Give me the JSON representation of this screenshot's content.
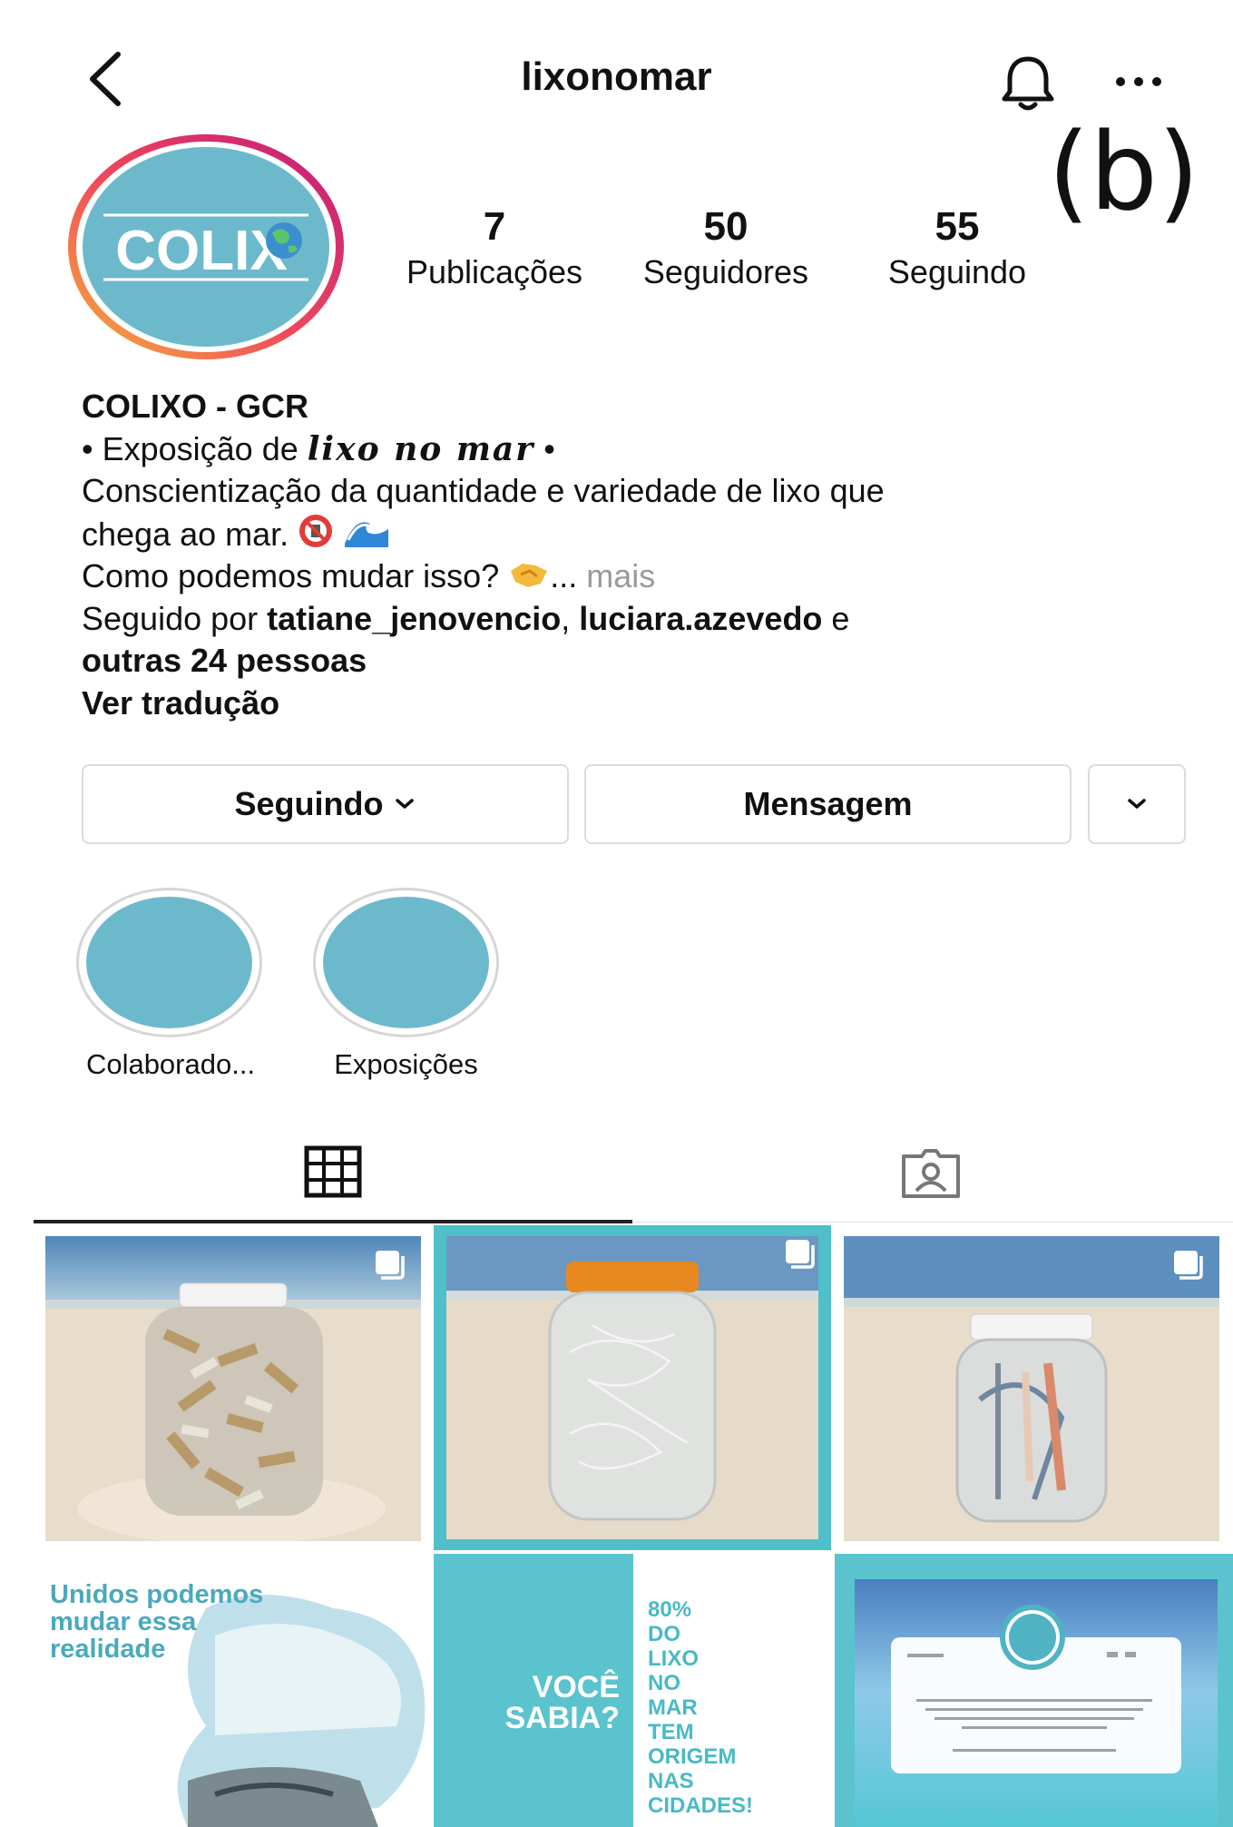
{
  "panel_label": "(b)",
  "header": {
    "title": "lixonomar"
  },
  "profile": {
    "avatar_text": "COLIX",
    "stats": [
      {
        "value": "7",
        "label": "Publicações"
      },
      {
        "value": "50",
        "label": "Seguidores"
      },
      {
        "value": "55",
        "label": "Seguindo"
      }
    ]
  },
  "bio": {
    "name": "COLIXO - GCR",
    "line1_prefix": "• Exposição de ",
    "line1_script": "lixo no mar",
    "line1_suffix": " •",
    "line2": "Conscientização da quantidade e variedade de lixo que",
    "line3": "chega ao mar.",
    "line4": "Como podemos mudar isso?",
    "more_ellipsis": "... ",
    "more": "mais",
    "followed_prefix": "Seguido por ",
    "follower1": "tatiane_jenovencio",
    "comma": ", ",
    "follower2": "luciara.azevedo",
    "and": " e",
    "others": "outras 24 pessoas",
    "translate": "Ver tradução"
  },
  "actions": {
    "following": "Seguindo",
    "message": "Mensagem"
  },
  "highlights": [
    {
      "label": "Colaborado..."
    },
    {
      "label": "Exposições"
    }
  ],
  "posts": {
    "tile4_text": "Unidos podemos mudar essa realidade",
    "tile4_lines": [
      "Unidos podemos",
      "mudar essa",
      "realidade"
    ],
    "tile5_left": [
      "VOCÊ",
      "SABIA?"
    ],
    "tile5_right": [
      "80%",
      "DO",
      "LIXO",
      "NO",
      "MAR",
      "TEM",
      "ORIGEM",
      "NAS",
      "CIDADES!"
    ]
  },
  "colors": {
    "brand_teal": "#6db9cc",
    "teal_dark": "#3aaec0",
    "text": "#111111",
    "muted": "#9a9a9a",
    "border": "#dcdcdc"
  },
  "icons": [
    "back-chevron-icon",
    "bell-icon",
    "more-icon",
    "chevron-down-icon",
    "grid-icon",
    "tagged-icon",
    "multiple-posts-icon"
  ]
}
